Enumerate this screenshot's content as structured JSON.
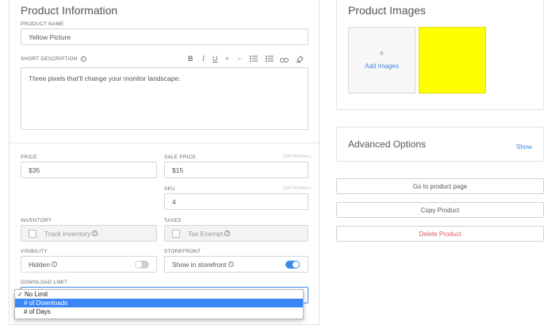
{
  "product_info": {
    "title": "Product Information",
    "name_label": "PRODUCT NAME",
    "name_value": "Yellow Picture",
    "desc_label": "SHORT DESCRIPTION",
    "desc_value": "Three pixels that'll change your monitor landscape.",
    "toolbar": {
      "bold": "B",
      "italic": "I",
      "underline": "U",
      "add": "+",
      "remove": "−"
    }
  },
  "pricing": {
    "price_label": "PRICE",
    "price_value": "$35",
    "sale_label": "SALE PRICE",
    "sale_optional": "(OPTIONAL)",
    "sale_value": "$15",
    "sku_label": "SKU",
    "sku_optional": "(OPTIONAL)",
    "sku_value": "4"
  },
  "inventory": {
    "label": "INVENTORY",
    "checkbox_label": "Track Inventory"
  },
  "taxes": {
    "label": "TAXES",
    "checkbox_label": "Tax Exempt"
  },
  "visibility": {
    "label": "VISIBILITY",
    "value": "Hidden",
    "on": false
  },
  "storefront": {
    "label": "STOREFRONT",
    "value": "Show in storefront",
    "on": true
  },
  "download_limit": {
    "label": "DOWNLOAD LIMIT",
    "options": [
      "No Limit",
      "# of Downloads",
      "# of Days"
    ],
    "checked_option": "No Limit",
    "highlighted_option": "# of Downloads",
    "check_mark": "✓"
  },
  "images": {
    "title": "Product Images",
    "add_plus": "+",
    "add_label": "Add Images",
    "thumb_color": "#ffff00"
  },
  "advanced": {
    "title": "Advanced Options",
    "show_link": "Show"
  },
  "actions": {
    "go_to_page": "Go to product page",
    "copy": "Copy Product",
    "delete": "Delete Product"
  },
  "colors": {
    "accent": "#3b8be6",
    "danger": "#e05a5a",
    "toggle_on": "#3b8be6",
    "toggle_off": "#cfcfcf"
  }
}
